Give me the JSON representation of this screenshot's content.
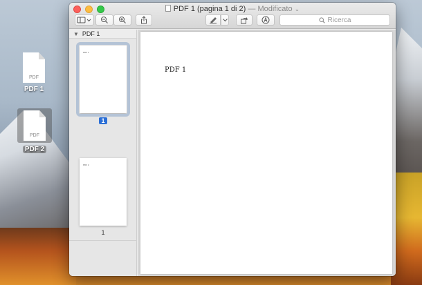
{
  "window": {
    "title": "PDF 1 (pagina 1 di 2)",
    "status": "— Modificato",
    "status_chevron": "⌄"
  },
  "toolbar": {
    "search_placeholder": "Ricerca"
  },
  "sidebar": {
    "document_name": "PDF 1",
    "pages": [
      {
        "number": "1",
        "selected": true
      },
      {
        "number": "1",
        "selected": false
      }
    ]
  },
  "page_content": {
    "text": "PDF 1"
  },
  "desktop": {
    "icons": [
      {
        "name": "PDF 1",
        "type_label": "PDF",
        "selected": false
      },
      {
        "name": "PDF 2",
        "type_label": "PDF",
        "selected": true
      }
    ]
  },
  "colors": {
    "accent": "#2b6fd6",
    "close": "#fc605c",
    "minimize": "#fdbc40",
    "maximize": "#34c84a"
  }
}
